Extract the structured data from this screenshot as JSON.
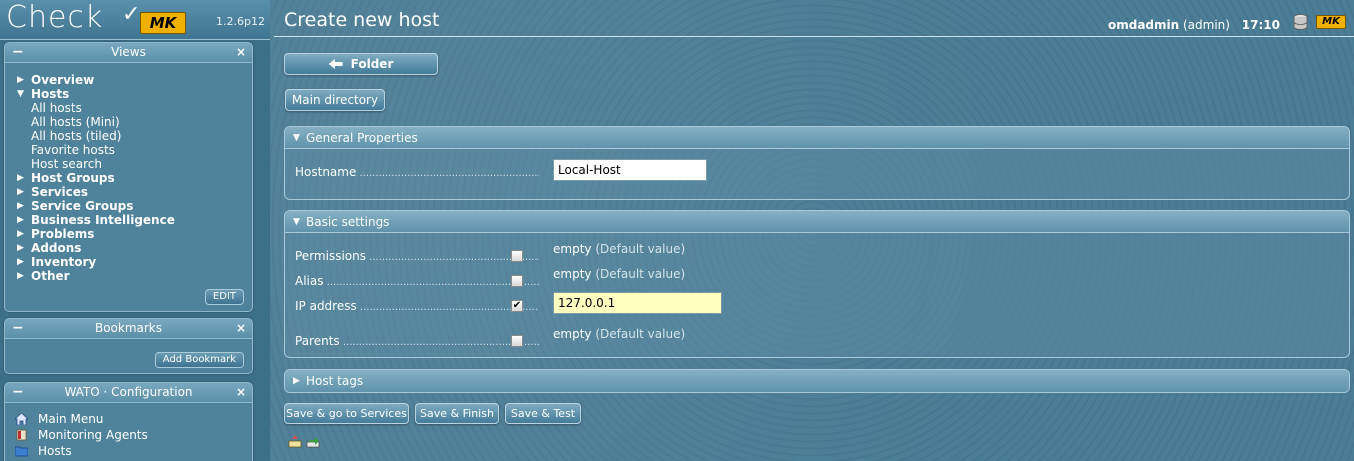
{
  "app": {
    "logo_text": "Check",
    "logo_badge": "MK",
    "version": "1.2.6p12"
  },
  "sidebar": {
    "views": {
      "title": "Views",
      "items": [
        {
          "label": "Overview",
          "expanded": false
        },
        {
          "label": "Hosts",
          "expanded": true,
          "children": [
            "All hosts",
            "All hosts (Mini)",
            "All hosts (tiled)",
            "Favorite hosts",
            "Host search"
          ]
        },
        {
          "label": "Host Groups",
          "expanded": false
        },
        {
          "label": "Services",
          "expanded": false
        },
        {
          "label": "Service Groups",
          "expanded": false
        },
        {
          "label": "Business Intelligence",
          "expanded": false
        },
        {
          "label": "Problems",
          "expanded": false
        },
        {
          "label": "Addons",
          "expanded": false
        },
        {
          "label": "Inventory",
          "expanded": false
        },
        {
          "label": "Other",
          "expanded": false
        }
      ],
      "edit_label": "EDIT"
    },
    "bookmarks": {
      "title": "Bookmarks",
      "add_label": "Add Bookmark"
    },
    "wato": {
      "title": "WATO · Configuration",
      "items": [
        {
          "label": "Main Menu",
          "icon": "home-icon"
        },
        {
          "label": "Monitoring Agents",
          "icon": "agents-icon"
        },
        {
          "label": "Hosts",
          "icon": "folder-icon"
        }
      ]
    }
  },
  "header": {
    "title": "Create new host",
    "user": "omdadmin",
    "role": "(admin)",
    "time": "17:10",
    "badge": "MK"
  },
  "buttons": {
    "folder": "Folder",
    "main_directory": "Main directory",
    "save_services": "Save & go to Services",
    "save_finish": "Save & Finish",
    "save_test": "Save & Test"
  },
  "general": {
    "title": "General Properties",
    "hostname_label": "Hostname",
    "hostname_value": "Local-Host"
  },
  "basic": {
    "title": "Basic settings",
    "permissions_label": "Permissions",
    "permissions_value": "empty",
    "permissions_hint": "(Default value)",
    "alias_label": "Alias",
    "alias_value": "empty",
    "alias_hint": "(Default value)",
    "ip_label": "IP address",
    "ip_value": "127.0.0.1",
    "parents_label": "Parents",
    "parents_value": "empty",
    "parents_hint": "(Default value)"
  },
  "hosttags": {
    "title": "Host tags"
  },
  "colors": {
    "background": "#4b7d96",
    "mk_badge": "#f0b000",
    "ip_highlight": "#ffffc0"
  }
}
